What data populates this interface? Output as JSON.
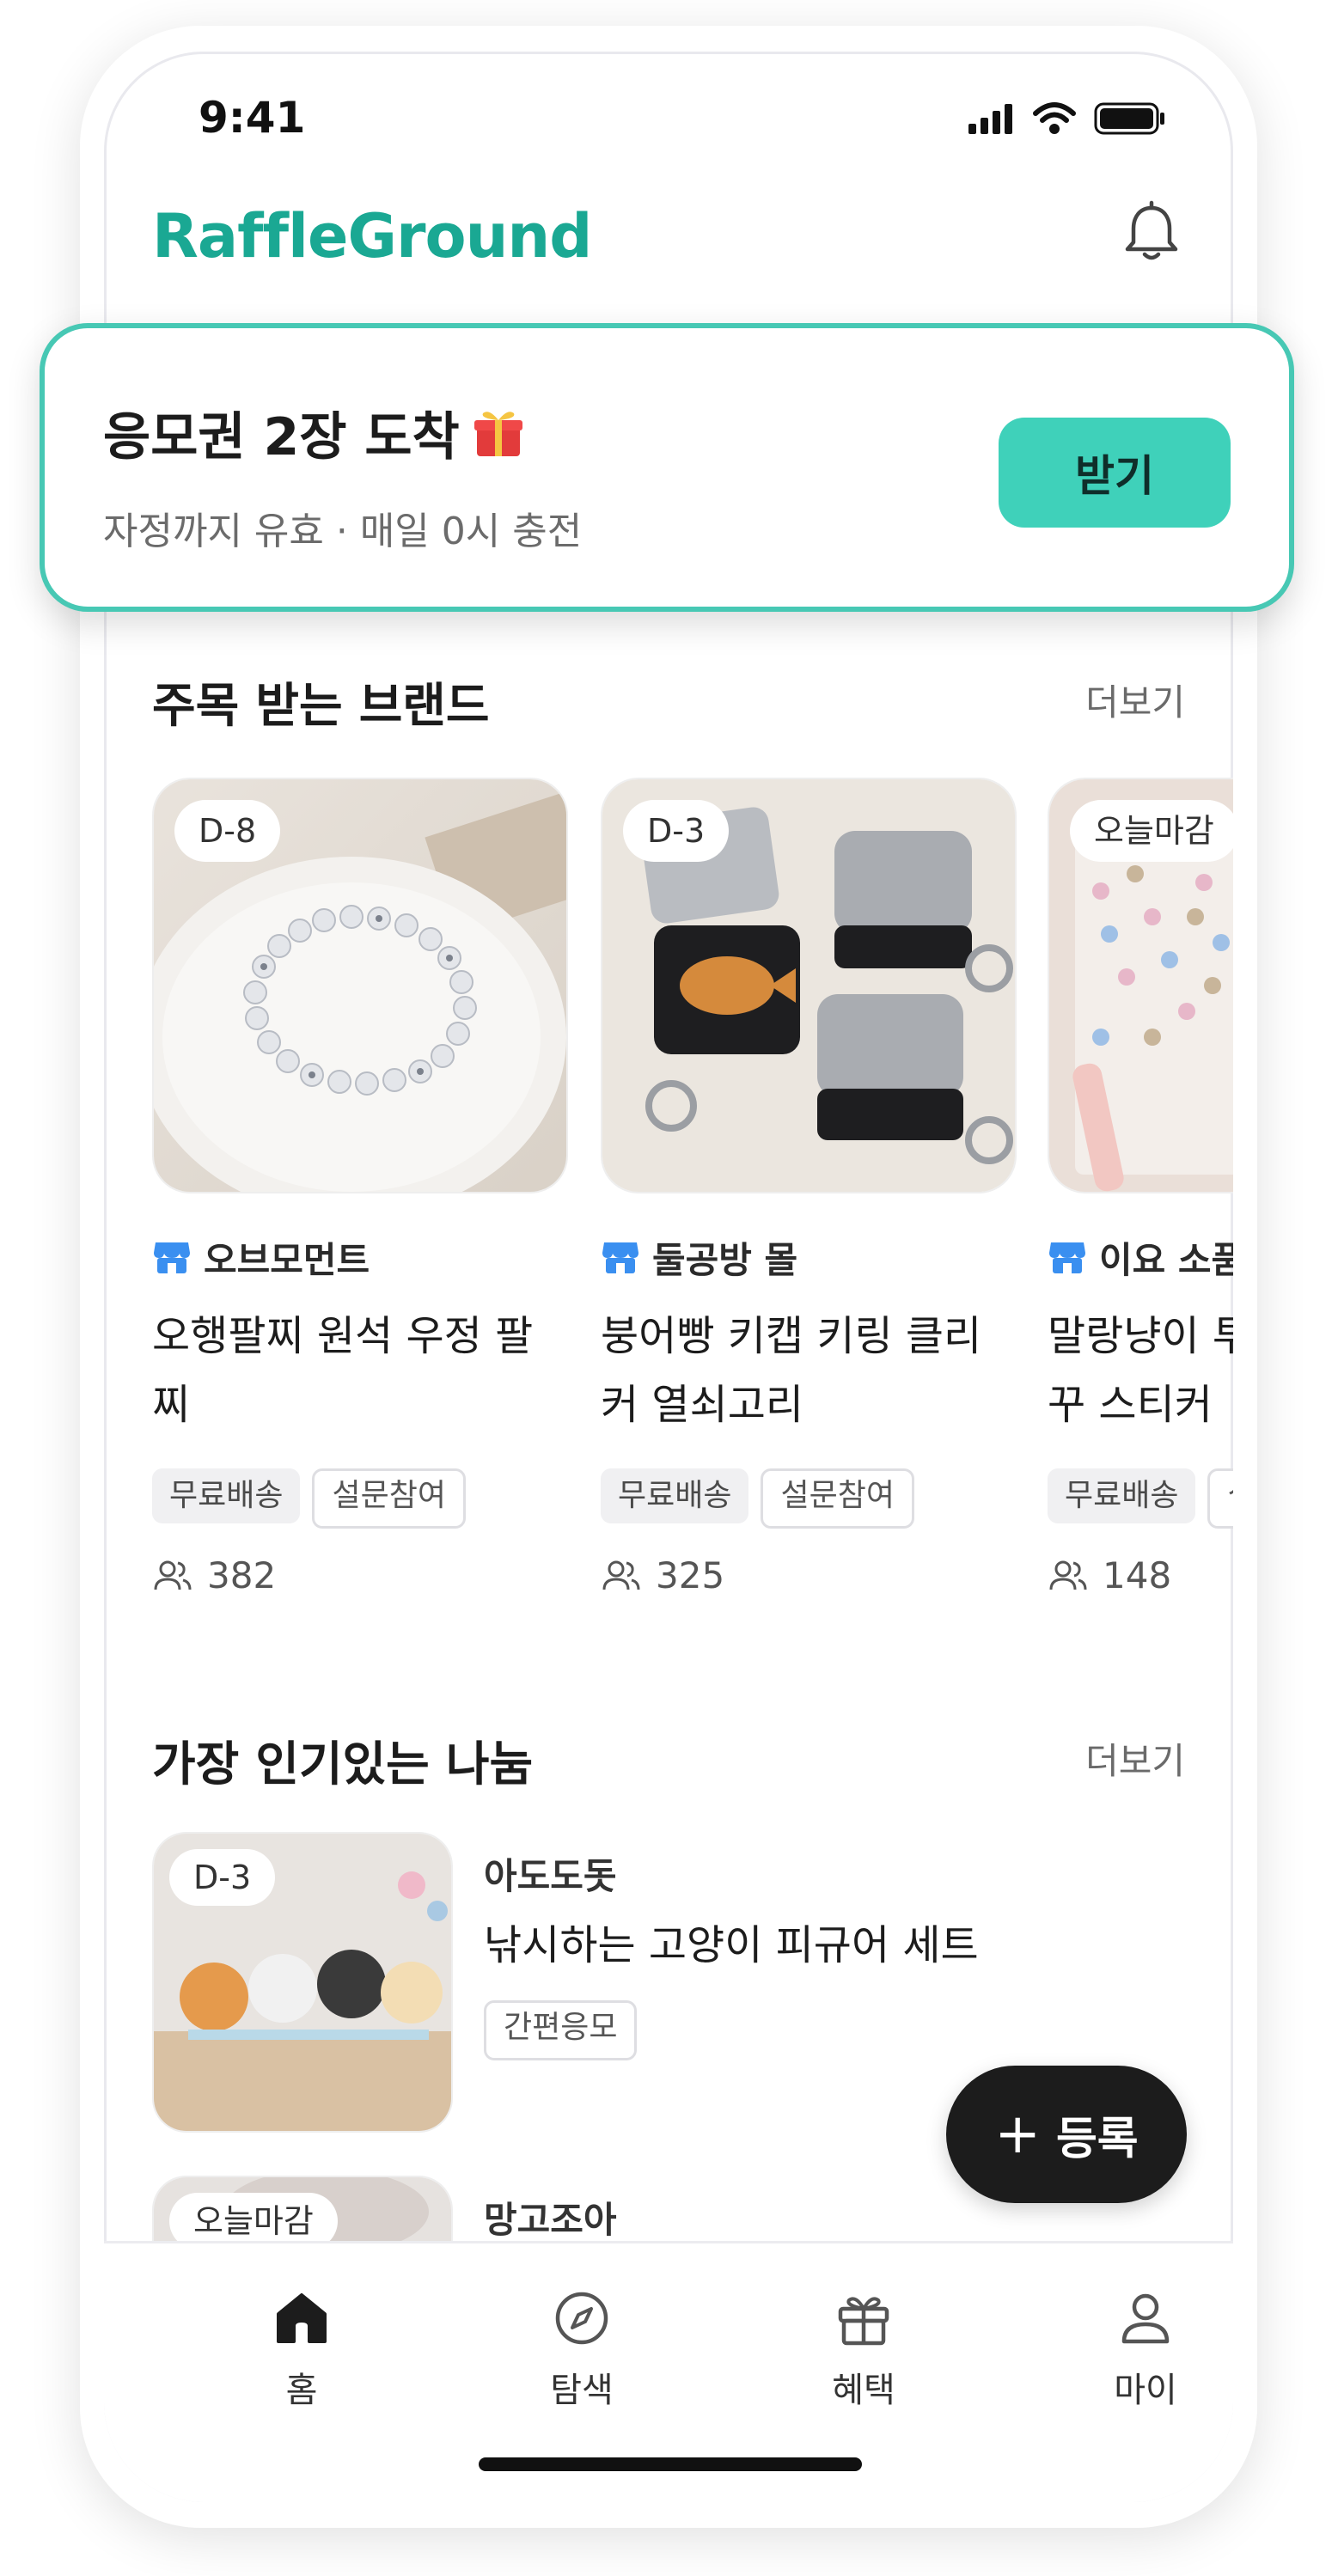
{
  "status_bar": {
    "time": "9:41",
    "icons": [
      "cellular-signal-icon",
      "wifi-icon",
      "battery-icon"
    ]
  },
  "header": {
    "logo": "RaffleGround",
    "bell_icon": "bell-icon"
  },
  "notice": {
    "title": "응모권 2장 도착",
    "emoji_icon": "gift-icon",
    "subtitle": "자정까지 유효 · 매일 0시 충전",
    "button": "받기"
  },
  "brands_section": {
    "title": "주목 받는 브랜드",
    "more": "더보기",
    "cards": [
      {
        "badge": "D-8",
        "brand": "오브모먼트",
        "title": "오행팔찌 원석 우정 팔찌",
        "tags": [
          "무료배송",
          "설문참여"
        ],
        "count": "382"
      },
      {
        "badge": "D-3",
        "brand": "둘공방 몰",
        "title": "붕어빵 키캡 키링 클리커 열쇠고리",
        "tags": [
          "무료배송",
          "설문참여"
        ],
        "count": "325"
      },
      {
        "badge": "오늘마감",
        "brand": "이요 소품",
        "title": "말랑냥이 투명 폰꾸 다꾸 스티커",
        "tags": [
          "무료배송",
          "설문참여"
        ],
        "count": "148"
      }
    ]
  },
  "popular_section": {
    "title": "가장 인기있는 나눔",
    "more": "더보기",
    "items": [
      {
        "badge": "D-3",
        "brand": "아도도돗",
        "title": "낚시하는 고양이 피규어 세트",
        "tag": "간편응모"
      },
      {
        "badge": "오늘마감",
        "brand": "망고조아"
      }
    ]
  },
  "fab": {
    "label": "등록",
    "icon": "plus-icon"
  },
  "tabbar": [
    {
      "label": "홈",
      "icon": "home-icon",
      "active": true
    },
    {
      "label": "탐색",
      "icon": "compass-icon",
      "active": false
    },
    {
      "label": "혜택",
      "icon": "gift-icon",
      "active": false
    },
    {
      "label": "마이",
      "icon": "user-icon",
      "active": false
    }
  ],
  "colors": {
    "brand": "#1aa893",
    "accent": "#3fd1ba",
    "notice_border": "#47c8b4",
    "store_icon": "#3a8ff0"
  }
}
